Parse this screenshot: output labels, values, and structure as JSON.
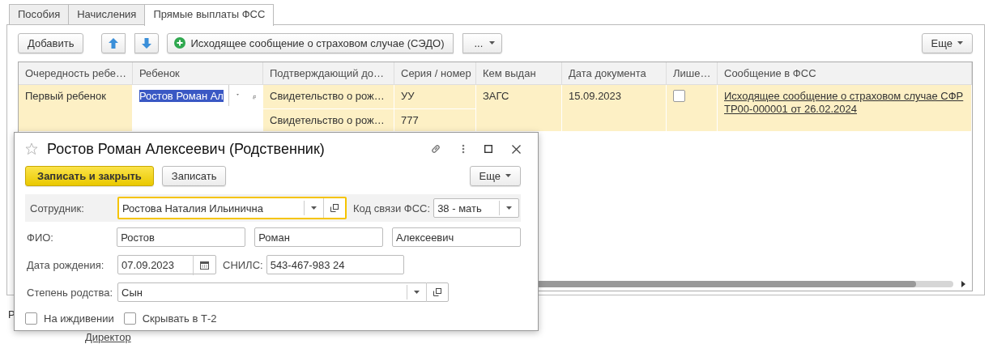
{
  "tabs": [
    {
      "label": "Пособия",
      "selected": false
    },
    {
      "label": "Начисления",
      "selected": false
    },
    {
      "label": "Прямые выплаты ФСС",
      "selected": true
    }
  ],
  "toolbar": {
    "add_button": "Добавить",
    "create_button": "Исходящее сообщение о страховом случае (СЭДО)",
    "more_button": "...",
    "menu_button": "Еще"
  },
  "table": {
    "columns": [
      "Очередность ребе…",
      "Ребенок",
      "Подтверждающий до…",
      "Серия / номер",
      "Кем выдан",
      "Дата документа",
      "Лише…",
      "Сообщение в ФСС"
    ],
    "rows": [
      {
        "order": "Первый ребенок",
        "child": "Ростов Роман Ал",
        "documents": [
          {
            "document": "Свидетельство о рож…",
            "series": "УУ"
          },
          {
            "document": "Свидетельство о рож…",
            "series": "777"
          }
        ],
        "issued_by": "ЗАГС",
        "document_date": "15.09.2023",
        "checked": false,
        "message": "Исходящее сообщение о страховом случае СФР ТР00-000001 от 26.02.2024"
      }
    ]
  },
  "background_texts": {
    "letter": "Р",
    "link": "Директор"
  },
  "dialog": {
    "title": "Ростов Роман Алексеевич (Родственник)",
    "buttons": {
      "save_close": "Записать и закрыть",
      "save": "Записать",
      "menu": "Еще"
    },
    "employee": {
      "label": "Сотрудник:",
      "value": "Ростова Наталия Ильинична"
    },
    "relation_code": {
      "label": "Код связи ФСС:",
      "value": "38 - мать"
    },
    "full_name": {
      "label": "ФИО:",
      "values": [
        "Ростов",
        "Роман",
        "Алексеевич"
      ]
    },
    "birth_date": {
      "label": "Дата рождения:",
      "value": "07.09.2023"
    },
    "snils": {
      "label": "СНИЛС:",
      "value": "543-467-983 24"
    },
    "kinship": {
      "label": "Степень родства:",
      "value": "Сын"
    },
    "checkboxes": [
      {
        "label": "На иждивении",
        "checked": false
      },
      {
        "label": "Скрывать в Т-2",
        "checked": false
      }
    ]
  }
}
